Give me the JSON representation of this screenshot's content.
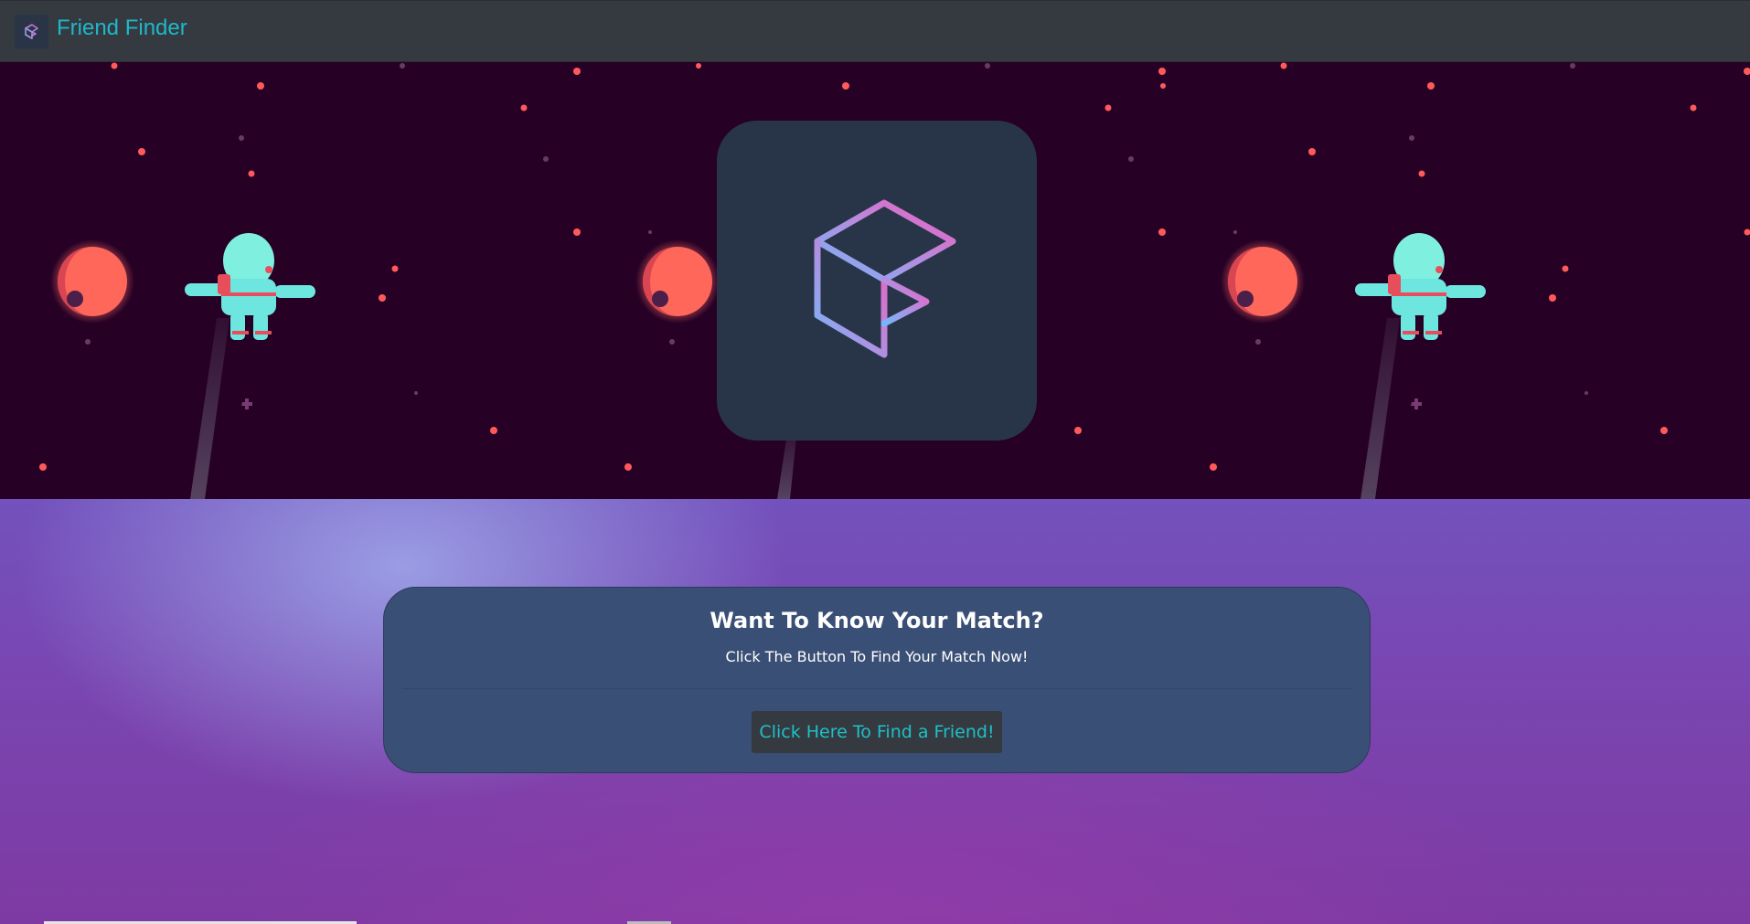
{
  "navbar": {
    "brand_title": "Friend Finder",
    "logo_icon": "cube-logo-icon",
    "bg_color": "#343a40",
    "title_color": "#1fb8c9"
  },
  "banner": {
    "bg_color": "#270026",
    "illustration": "space-astronaut-planets",
    "logo_icon": "cube-logo-icon"
  },
  "match_card": {
    "title": "Want To Know Your Match?",
    "subtitle": "Click The Button To Find Your Match Now!",
    "button_label": "Click Here To Find a Friend!",
    "button_text_color": "#1fc0c8"
  }
}
